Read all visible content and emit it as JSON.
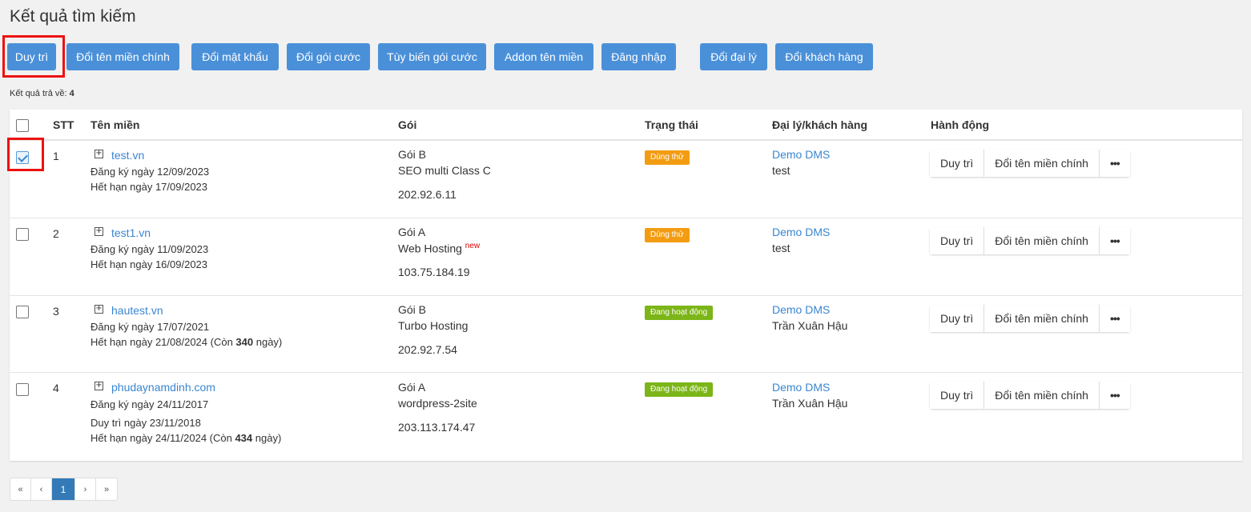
{
  "page_title": "Kết quả tìm kiếm",
  "toolbar": {
    "buttons": [
      "Duy trì",
      "Đổi tên miền chính",
      "Đổi mật khẩu",
      "Đổi gói cước",
      "Tùy biến gói cước",
      "Addon tên miền",
      "Đăng nhập",
      "Đổi đại lý",
      "Đổi khách hàng"
    ]
  },
  "result": {
    "label": "Kết quả trả về:",
    "count": "4"
  },
  "table": {
    "headers": [
      "STT",
      "Tên miền",
      "Gói",
      "Trạng thái",
      "Đại lý/khách hàng",
      "Hành động"
    ],
    "rows": [
      {
        "stt": "1",
        "checked": true,
        "domain": "test.vn",
        "lines": [
          "Đăng ký ngày 12/09/2023",
          "Hết hạn ngày 17/09/2023"
        ],
        "package": "Gói B",
        "plan": "SEO multi Class C",
        "plan_sup": "",
        "ip": "202.92.6.11",
        "status": "Dùng thử",
        "agent": "Demo DMS",
        "customer": "test"
      },
      {
        "stt": "2",
        "checked": false,
        "domain": "test1.vn",
        "lines": [
          "Đăng ký ngày 11/09/2023",
          "Hết hạn ngày 16/09/2023"
        ],
        "package": "Gói A",
        "plan": "Web Hosting",
        "plan_sup": "new",
        "ip": "103.75.184.19",
        "status": "Dùng thử",
        "agent": "Demo DMS",
        "customer": "test"
      },
      {
        "stt": "3",
        "checked": false,
        "domain": "hautest.vn",
        "lines": [
          "Đăng ký ngày 17/07/2021",
          "Hết hạn ngày 21/08/2024 (Còn ",
          "340",
          " ngày)"
        ],
        "package": "Gói B",
        "plan": "Turbo Hosting",
        "plan_sup": "",
        "ip": "202.92.7.54",
        "status": "Đang hoạt động",
        "agent": "Demo DMS",
        "customer": "Trần Xuân Hậu"
      },
      {
        "stt": "4",
        "checked": false,
        "domain": "phudaynamdinh.com",
        "lines": [
          "Đăng ký ngày 24/11/2017",
          "Duy trì ngày 23/11/2018",
          "Hết hạn ngày 24/11/2024 (Còn ",
          "434",
          " ngày)"
        ],
        "package": "Gói A",
        "plan": "wordpress-2site",
        "plan_sup": "",
        "ip": "203.113.174.47",
        "status": "Đang hoạt động",
        "agent": "Demo DMS",
        "customer": "Trần Xuân Hậu"
      }
    ],
    "row_actions": {
      "renew": "Duy trì",
      "change_domain": "Đổi tên miền chính",
      "more": "•••"
    }
  },
  "pagination": {
    "first": "«",
    "prev": "‹",
    "current": "1",
    "next": "›",
    "last": "»"
  },
  "colors": {
    "primary": "#4a90d9",
    "trial": "#f39c12",
    "active": "#7cb518",
    "link": "#3a86d1",
    "highlight": "#e11111"
  }
}
